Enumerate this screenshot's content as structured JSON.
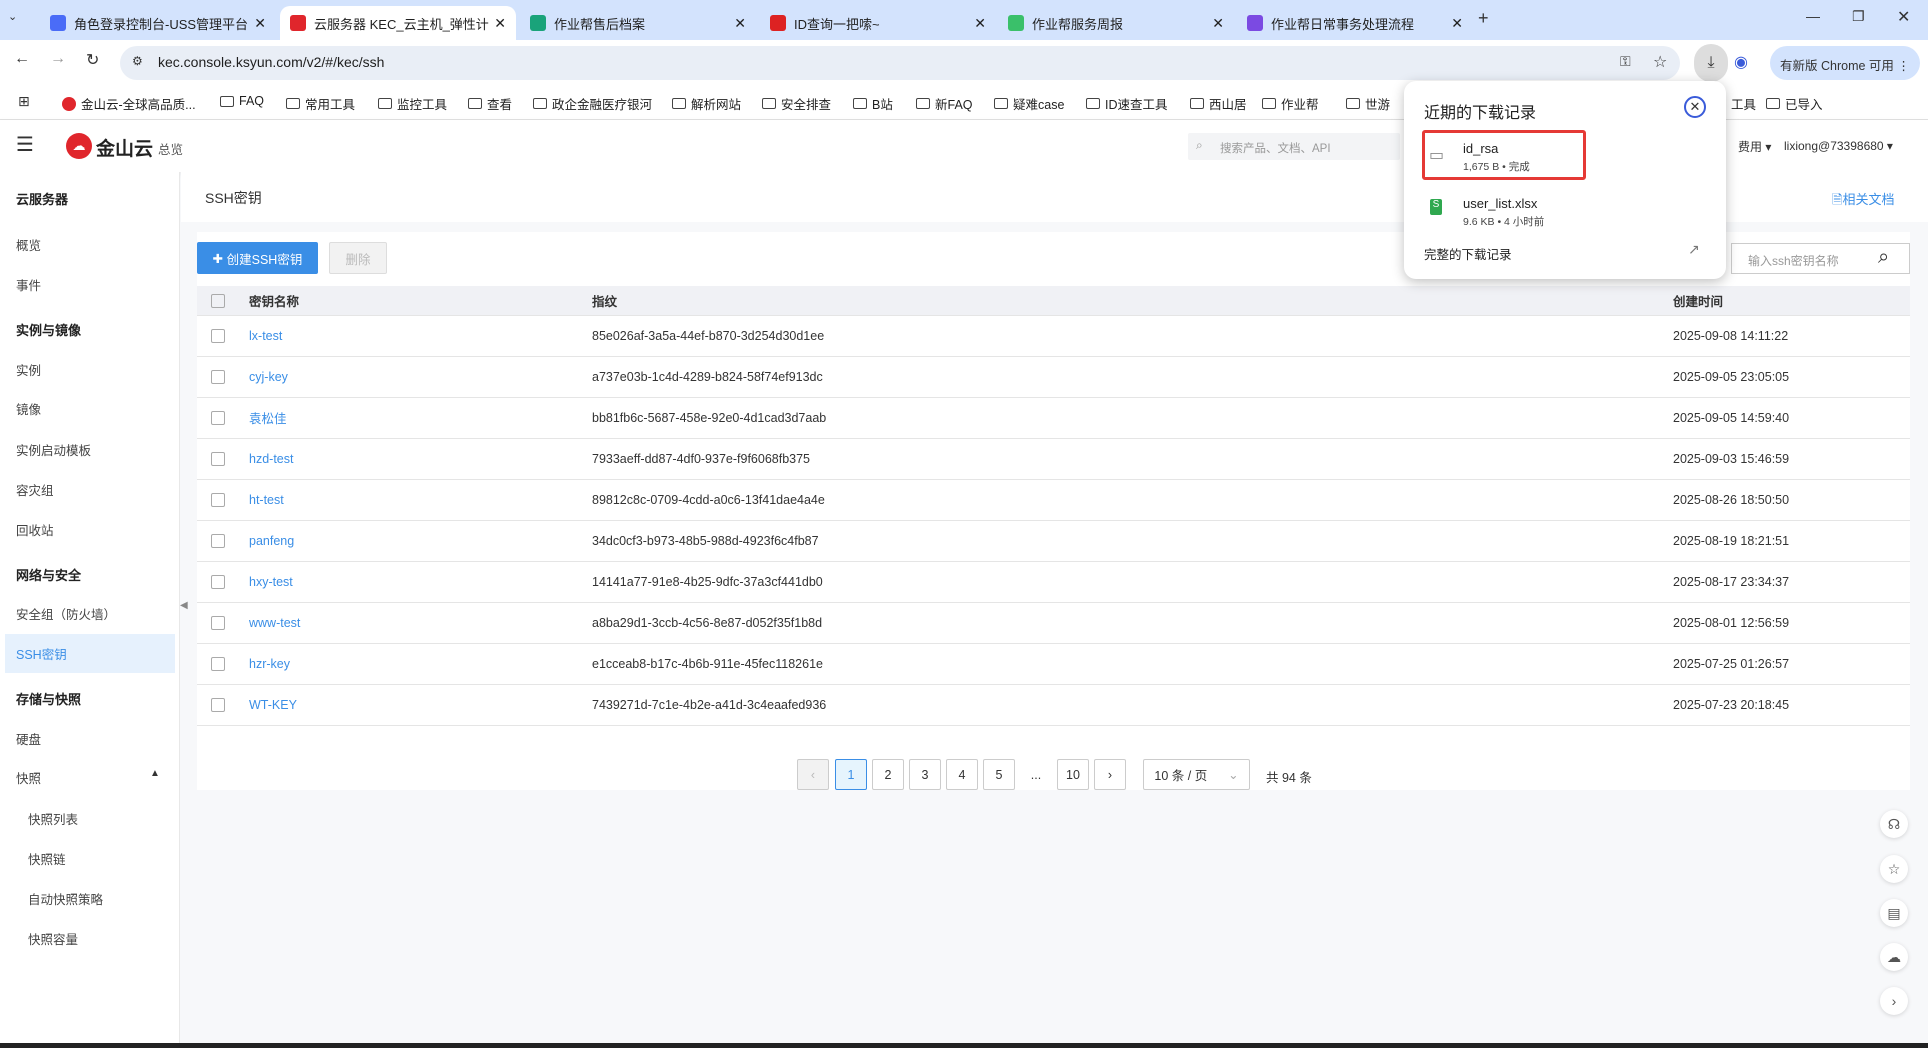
{
  "browser": {
    "tabs": [
      {
        "title": "角色登录控制台-USS管理平台",
        "color": "#4a6cf7"
      },
      {
        "title": "云服务器 KEC_云主机_弹性计算",
        "color": "#e0262c"
      },
      {
        "title": "作业帮售后档案",
        "color": "#1aa37a"
      },
      {
        "title": "ID查询一把嗦~",
        "color": "#d22"
      },
      {
        "title": "作业帮服务周报",
        "color": "#3ac06a"
      },
      {
        "title": "作业帮日常事务处理流程",
        "color": "#7b4ae2"
      }
    ],
    "new_tab": "+",
    "url": "kec.console.ksyun.com/v2/#/kec/ssh",
    "update_label": "有新版 Chrome 可用",
    "bookmarks": [
      "金山云-全球高品质...",
      "FAQ",
      "常用工具",
      "监控工具",
      "查看",
      "政企金融医疗银河",
      "解析网站",
      "安全排查",
      "B站",
      "新FAQ",
      "疑难case",
      "ID速查工具",
      "西山居",
      "作业帮",
      "世游",
      "工具",
      "已导入"
    ]
  },
  "downloads": {
    "title": "近期的下载记录",
    "items": [
      {
        "name": "id_rsa",
        "meta": "1,675 B • 完成"
      },
      {
        "name": "user_list.xlsx",
        "meta": "9.6 KB • 4 小时前"
      }
    ],
    "full_history": "完整的下载记录"
  },
  "app": {
    "brand": "金山云",
    "overview": "总览",
    "search_placeholder": "搜索产品、文档、API",
    "fees": "费用",
    "user": "lixiong@73398680"
  },
  "sidebar": {
    "items": [
      {
        "label": "云服务器",
        "type": "h"
      },
      {
        "label": "概览"
      },
      {
        "label": "事件"
      },
      {
        "label": "实例与镜像",
        "type": "h"
      },
      {
        "label": "实例"
      },
      {
        "label": "镜像"
      },
      {
        "label": "实例启动模板"
      },
      {
        "label": "容灾组"
      },
      {
        "label": "回收站"
      },
      {
        "label": "网络与安全",
        "type": "h"
      },
      {
        "label": "安全组（防火墙）"
      },
      {
        "label": "SSH密钥",
        "active": true
      },
      {
        "label": "存储与快照",
        "type": "h"
      },
      {
        "label": "硬盘"
      },
      {
        "label": "快照"
      },
      {
        "label": "快照列表",
        "type": "sub"
      },
      {
        "label": "快照链",
        "type": "sub"
      },
      {
        "label": "自动快照策略",
        "type": "sub"
      },
      {
        "label": "快照容量",
        "type": "sub"
      }
    ]
  },
  "page": {
    "title": "SSH密钥",
    "docs": "相关文档",
    "create": "创建SSH密钥",
    "delete": "删除",
    "search_placeholder": "输入ssh密钥名称",
    "columns": [
      "密钥名称",
      "指纹",
      "创建时间"
    ],
    "rows": [
      [
        "lx-test",
        "85e026af-3a5a-44ef-b870-3d254d30d1ee",
        "2025-09-08 14:11:22"
      ],
      [
        "cyj-key",
        "a737e03b-1c4d-4289-b824-58f74ef913dc",
        "2025-09-05 23:05:05"
      ],
      [
        "袁松佳",
        "bb81fb6c-5687-458e-92e0-4d1cad3d7aab",
        "2025-09-05 14:59:40"
      ],
      [
        "hzd-test",
        "7933aeff-dd87-4df0-937e-f9f6068fb375",
        "2025-09-03 15:46:59"
      ],
      [
        "ht-test",
        "89812c8c-0709-4cdd-a0c6-13f41dae4a4e",
        "2025-08-26 18:50:50"
      ],
      [
        "panfeng",
        "34dc0cf3-b973-48b5-988d-4923f6c4fb87",
        "2025-08-19 18:21:51"
      ],
      [
        "hxy-test",
        "14141a77-91e8-4b25-9dfc-37a3cf441db0",
        "2025-08-17 23:34:37"
      ],
      [
        "www-test",
        "a8ba29d1-3ccb-4c56-8e87-d052f35f1b8d",
        "2025-08-01 12:56:59"
      ],
      [
        "hzr-key",
        "e1cceab8-b17c-4b6b-911e-45fec118261e",
        "2025-07-25 01:26:57"
      ],
      [
        "WT-KEY",
        "7439271d-7c1e-4b2e-a41d-3c4eaafed936",
        "2025-07-23 20:18:45"
      ]
    ],
    "pagination": {
      "pages": [
        "1",
        "2",
        "3",
        "4",
        "5",
        "...",
        "10"
      ],
      "current": "1",
      "page_size": "10 条 / 页",
      "total": "共 94 条"
    }
  },
  "colors": {
    "accent": "#3a8ee6",
    "brand_red": "#e0262c",
    "highlight": "#e53935"
  }
}
